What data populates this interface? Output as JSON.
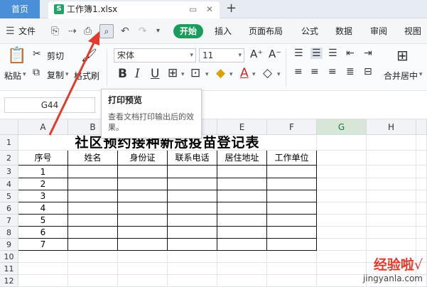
{
  "tabs": {
    "home": "首页",
    "file_icon_letter": "S",
    "file_name": "工作簿1.xlsx"
  },
  "menu": {
    "file": "文件",
    "items": [
      "开始",
      "插入",
      "页面布局",
      "公式",
      "数据",
      "审阅",
      "视图"
    ]
  },
  "ribbon": {
    "paste": "粘贴",
    "cut": "剪切",
    "copy": "复制",
    "format_painter": "格式刷",
    "font_name": "宋体",
    "font_size": "11",
    "merge_center": "合并居中"
  },
  "formula_bar": {
    "name_box": "G44"
  },
  "tooltip": {
    "title": "打印预览",
    "description": "查看文档打印输出后的效果。"
  },
  "sheet": {
    "columns": [
      "A",
      "B",
      "C",
      "D",
      "E",
      "F",
      "G",
      "H"
    ],
    "rows": [
      "1",
      "2",
      "3",
      "4",
      "5",
      "6",
      "7",
      "8",
      "9",
      "10",
      "11",
      "12"
    ],
    "title": "社区预约接种新冠疫苗登记表",
    "headers": [
      "序号",
      "姓名",
      "身份证",
      "联系电话",
      "居住地址",
      "工作单位"
    ],
    "serials": [
      "1",
      "2",
      "3",
      "4",
      "5",
      "6",
      "7"
    ],
    "selected_column": "G"
  },
  "watermark": {
    "line1": "经验啦",
    "check": "√",
    "line2": "jingyanla.com"
  },
  "colors": {
    "accent_green": "#1a9d5b",
    "home_tab_blue": "#4a90d9",
    "arrow_red": "#e03b2c"
  }
}
